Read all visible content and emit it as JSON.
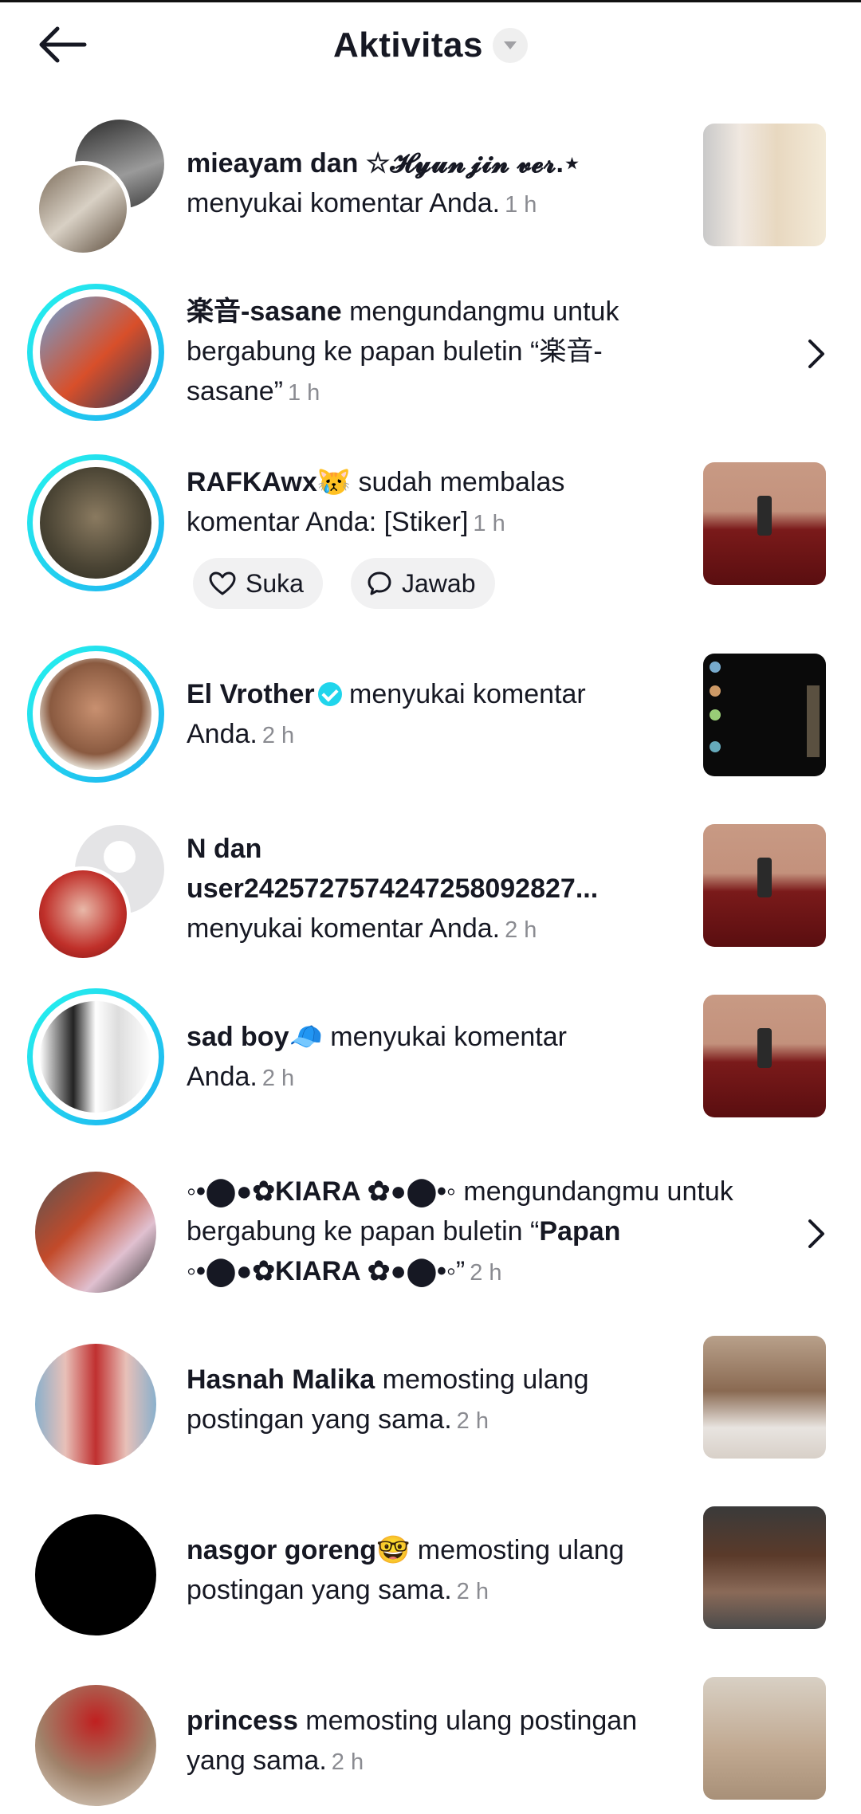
{
  "header": {
    "title": "Aktivitas"
  },
  "notifications": [
    {
      "user": "mieayam dan ☆𝓗𝔂𝓾𝓷𝓳𝓲𝓷 𝓿𝓮𝓻.⋆",
      "action": " menyukai komentar Anda.",
      "time": "1 h"
    },
    {
      "user": "楽音-sasane",
      "action": " mengundangmu untuk bergabung ke papan buletin “楽音-sasane”",
      "time": "1 h"
    },
    {
      "user": "RAFKAwx😿",
      "action": " sudah membalas komentar Anda: [Stiker]",
      "time": "1 h",
      "like_label": "Suka",
      "reply_label": "Jawab"
    },
    {
      "user": "El Vrother",
      "action": " menyukai komentar Anda.",
      "time": "2 h"
    },
    {
      "user": "N dan user2425727574247258092827...",
      "action": " menyukai komentar Anda.",
      "time": "2 h"
    },
    {
      "user": "sad boy🧢",
      "action": " menyukai komentar Anda.",
      "time": "2 h"
    },
    {
      "user": "◦•⬤●✿KIARA ✿●⬤•◦",
      "action": " mengundangmu untuk bergabung ke papan buletin “",
      "user2": "Papan ◦•⬤●✿KIARA ✿●⬤•◦",
      "action2": "”",
      "time": "2 h"
    },
    {
      "user": "Hasnah Malika",
      "action": " memosting ulang postingan yang sama.",
      "time": "2 h"
    },
    {
      "user": "nasgor goreng🤓",
      "action": " memosting ulang postingan yang sama.",
      "time": "2 h"
    },
    {
      "user": "princess",
      "action": " memosting ulang postingan yang sama.",
      "time": "2 h"
    }
  ],
  "icons": {
    "back": "arrow-left-icon",
    "caret": "caret-down-icon",
    "chevron": "chevron-right-icon",
    "heart": "heart-icon",
    "comment": "comment-icon",
    "verified": "verified-badge-icon"
  },
  "colors": {
    "ring": "#20d5ec",
    "time": "#8a8b91",
    "pill": "#f1f1f2"
  }
}
